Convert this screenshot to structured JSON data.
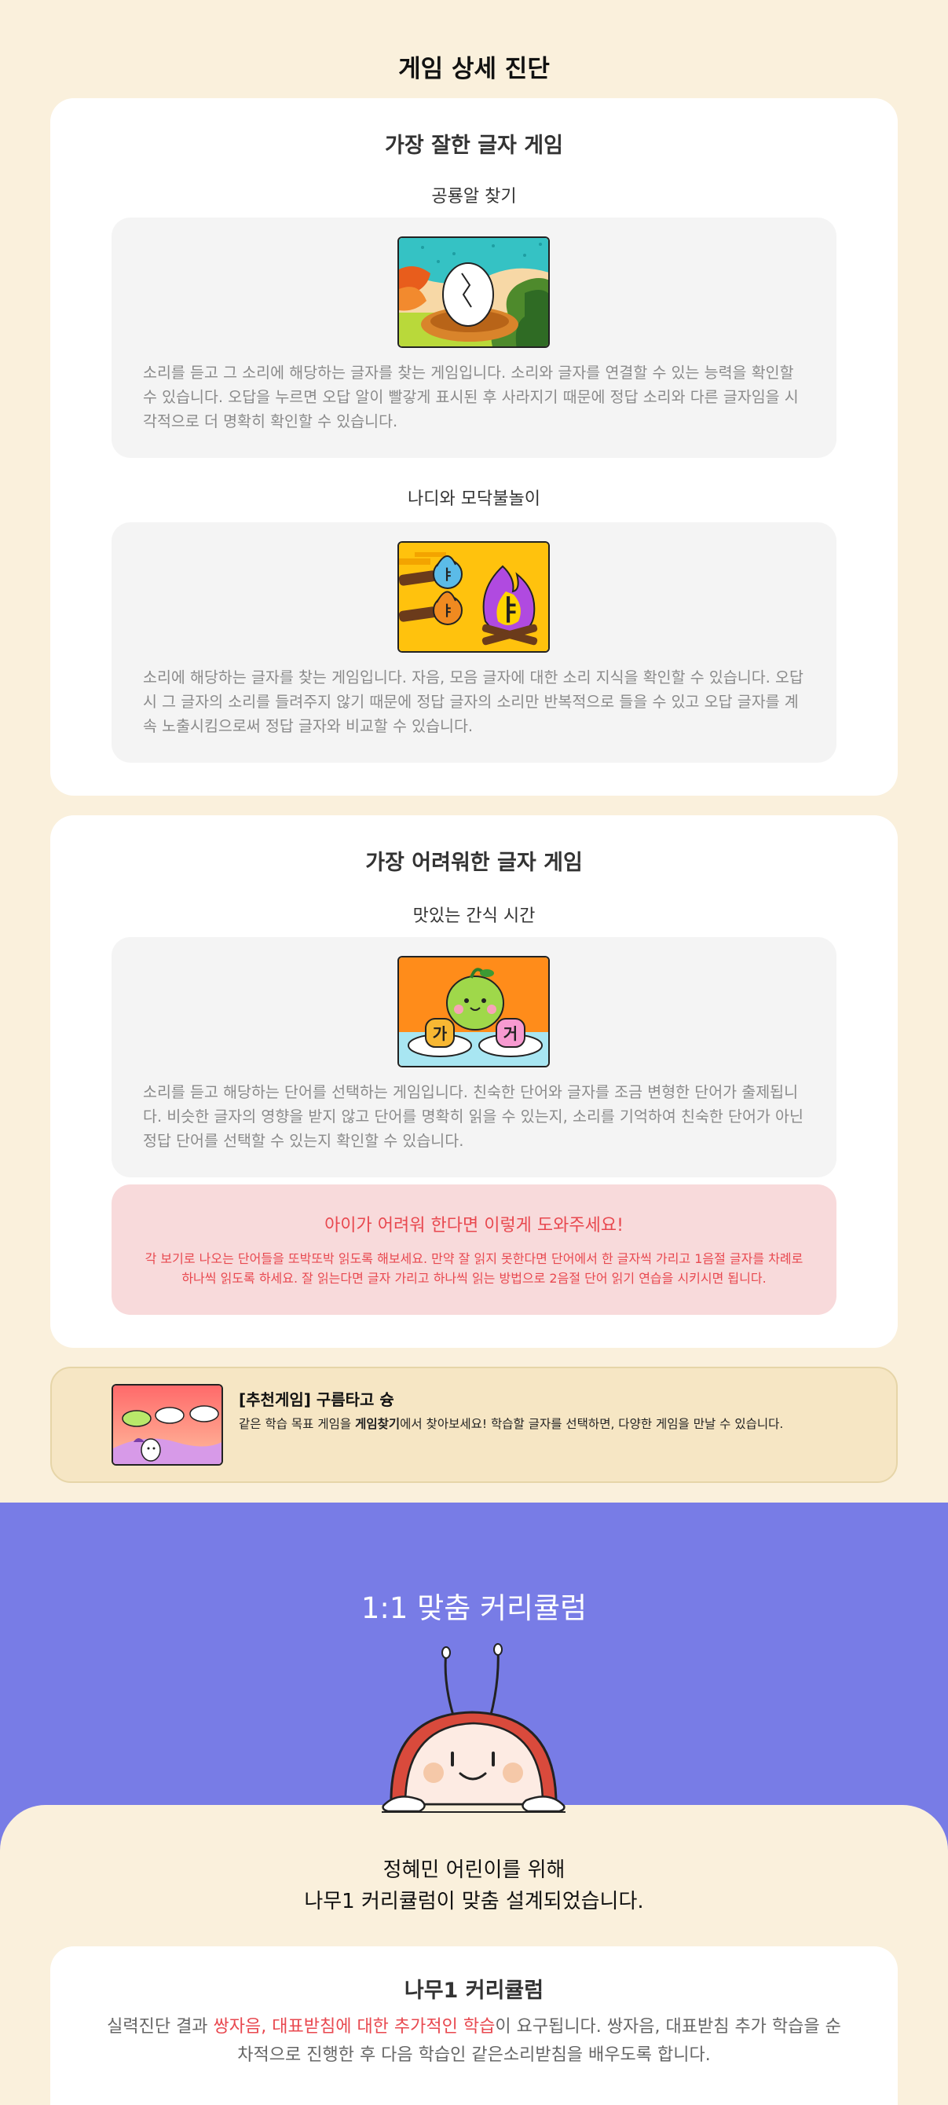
{
  "page_title": "게임 상세 진단",
  "best_section": {
    "heading": "가장 잘한 글자 게임",
    "games": [
      {
        "name": "공룡알 찾기",
        "thumbnail_icon": "dinosaur-egg-nest",
        "description": "소리를 듣고 그 소리에 해당하는 글자를 찾는 게임입니다. 소리와 글자를 연결할 수 있는 능력을 확인할 수 있습니다. 오답을 누르면 오답 알이 빨갛게 표시된 후 사라지기 때문에 정답 소리와 다른 글자임을 시각적으로 더 명확히 확인할 수 있습니다."
      },
      {
        "name": "나디와 모닥불놀이",
        "thumbnail_icon": "campfire-letters",
        "description": "소리에 해당하는 글자를 찾는 게임입니다. 자음, 모음 글자에 대한 소리 지식을 확인할 수 있습니다. 오답 시 그 글자의 소리를 들려주지 않기 때문에 정답 글자의 소리만 반복적으로 들을 수 있고 오답 글자를 계속 노출시킴으로써 정답 글자와 비교할 수 있습니다."
      }
    ],
    "fire_letters": [
      "ㅑ",
      "ㅑ",
      "ㅑ"
    ]
  },
  "hard_section": {
    "heading": "가장 어려워한 글자 게임",
    "game": {
      "name": "맛있는 간식 시간",
      "thumbnail_icon": "snack-time-bird",
      "description": "소리를 듣고 해당하는 단어를 선택하는 게임입니다. 친숙한 단어와 글자를 조금 변형한 단어가 출제됩니다. 비슷한 글자의 영향을 받지 않고 단어를 명확히 읽을 수 있는지, 소리를 기억하여 친숙한 단어가 아닌 정답 단어를 선택할 수 있는지 확인할 수 있습니다.",
      "tiles": [
        "가",
        "거"
      ]
    },
    "help": {
      "title": "아이가 어려워 한다면 이렇게 도와주세요!",
      "text": "각 보기로 나오는 단어들을 또박또박 읽도록 해보세요. 만약 잘 읽지 못한다면 단어에서 한 글자씩 가리고 1음절 글자를 차례로 하나씩 읽도록 하세요. 잘 읽는다면 글자 가리고 하나씩 읽는 방법으로 2음절 단어 읽기 연습을 시키시면 됩니다."
    }
  },
  "recommend": {
    "title": "[추천게임] 구름타고 슝",
    "desc_before": "같은 학습 목표 게임을 ",
    "desc_bold": "게임찾기",
    "desc_after": "에서 찾아보세요! 학습할 글자를 선택하면, 다양한 게임을 만날 수 있습니다.",
    "thumbnail_icon": "cloud-ride"
  },
  "curriculum": {
    "title": "1:1 맞춤 커리큘럼",
    "mascot_icon": "ladybug-mascot",
    "dedicate_line1": "정혜민 어린이를 위해",
    "dedicate_line2": "나무1 커리큘럼이 맞춤 설계되었습니다.",
    "card_title": "나무1 커리큘럼",
    "text_before": "실력진단 결과 ",
    "text_highlight": "쌍자음, 대표받침에 대한 추가적인 학습",
    "text_after": "이 요구됩니다. 쌍자음, 대표받침 추가 학습을 순차적으로 진행한 후 다음 학습인 같은소리받침을 배우도록 합니다."
  },
  "colors": {
    "background": "#faf0dc",
    "card": "#ffffff",
    "game_box": "#f4f4f4",
    "help_box": "#f8dadb",
    "accent_red": "#e8484f",
    "recommend_box": "#f6e6c4",
    "purple": "#787ce6"
  }
}
